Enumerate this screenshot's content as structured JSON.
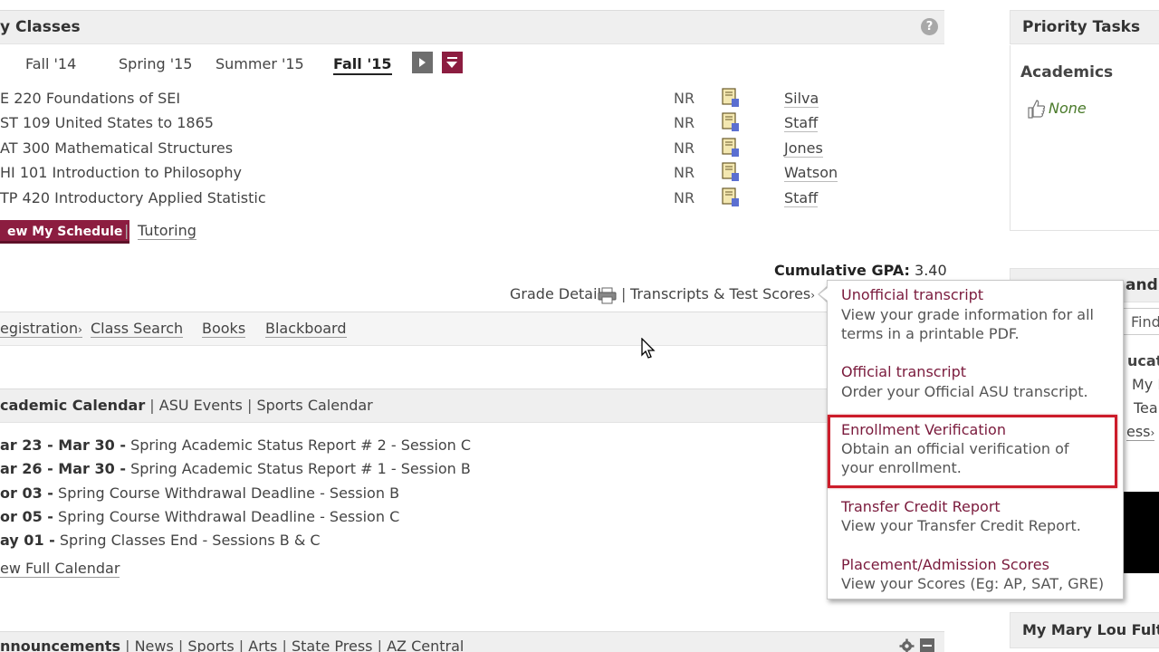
{
  "classes": {
    "title": "y Classes",
    "terms": [
      "Fall '14",
      "Spring '15",
      "Summer '15",
      "Fall '15"
    ],
    "rows": [
      {
        "course": "E 220 Foundations of SEI",
        "grade": "NR",
        "instructor": "Silva"
      },
      {
        "course": "ST 109 United States to 1865",
        "grade": "NR",
        "instructor": "Staff"
      },
      {
        "course": "AT 300 Mathematical Structures",
        "grade": "NR",
        "instructor": "Jones"
      },
      {
        "course": "HI 101 Introduction to Philosophy",
        "grade": "NR",
        "instructor": "Watson"
      },
      {
        "course": "TP 420 Introductory Applied Statistic",
        "grade": "NR",
        "instructor": "Staff"
      }
    ],
    "schedule_button": "ew My Schedule",
    "tutoring": "Tutoring",
    "gpa_label": "Cumulative GPA:",
    "gpa_value": "3.40",
    "grade_detail": "Grade Detail",
    "transcripts": "Transcripts & Test Scores"
  },
  "links_bar": {
    "items": [
      "egistration",
      "Class Search",
      "Books",
      "Blackboard"
    ]
  },
  "calendar": {
    "head_bold": "cademic Calendar",
    "head_links": [
      "ASU Events",
      "Sports Calendar"
    ],
    "events": [
      {
        "date": "ar 23 - Mar 30 -",
        "text": "Spring Academic Status Report # 2 - Session C"
      },
      {
        "date": "ar 26 - Mar 30 -",
        "text": "Spring Academic Status Report # 1 - Session B"
      },
      {
        "date": "or 03 -",
        "text": "Spring Course Withdrawal Deadline - Session B"
      },
      {
        "date": "or 05 -",
        "text": "Spring Course Withdrawal Deadline - Session C"
      },
      {
        "date": "ay 01 -",
        "text": "Spring Classes End - Sessions B & C"
      }
    ],
    "full_calendar": "ew Full Calendar"
  },
  "announcements": {
    "head_bold": "nnouncements",
    "links": [
      "News",
      "Sports",
      "Arts",
      "State Press",
      "AZ Central"
    ]
  },
  "popup": {
    "items": [
      {
        "title": "Unofficial transcript",
        "desc": "View your grade information for all terms in a printable PDF."
      },
      {
        "title": "Official transcript",
        "desc": "Order your Official ASU transcript."
      },
      {
        "title": "Enrollment Verification",
        "desc": "Obtain an official verification of your enrollment."
      },
      {
        "title": "Transfer Credit Report",
        "desc": "View your Transfer Credit Report."
      },
      {
        "title": "Placement/Admission Scores",
        "desc": "View your Scores (Eg: AP, SAT, GRE)"
      }
    ]
  },
  "right": {
    "priority_title": "Priority Tasks",
    "academics": "Academics",
    "none": "None",
    "panel2_title": "and",
    "find": "Find",
    "educ": "ucatio",
    "my": "My I",
    "tea": "Tea",
    "ess": "ess",
    "bottom_title": "My Mary Lou Fulto"
  },
  "colors": {
    "maroon": "#8c1d40",
    "highlight": "#cc1c2a"
  }
}
